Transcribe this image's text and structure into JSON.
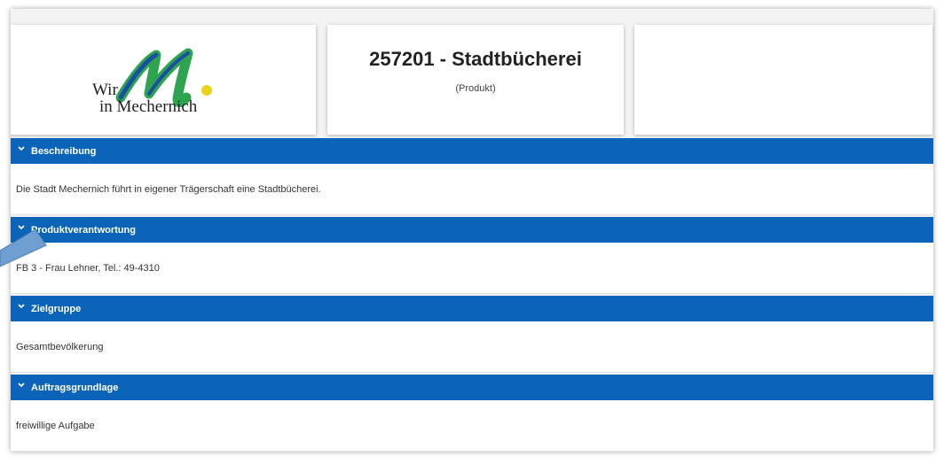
{
  "header": {
    "logo": {
      "line1": "Wir",
      "line2": "in Mechernich",
      "mark_colors": {
        "green": "#2ea44f",
        "blue": "#1a4fa3",
        "yellow": "#e8d21a"
      }
    },
    "title": "257201 - Stadtbücherei",
    "subtitle": "(Produkt)"
  },
  "sections": [
    {
      "label": "Beschreibung",
      "content": "Die Stadt Mechernich führt in eigener Trägerschaft eine Stadtbücherei."
    },
    {
      "label": "Produktverantwortung",
      "content": "FB 3 - Frau Lehner, Tel.: 49-4310"
    },
    {
      "label": "Zielgruppe",
      "content": "Gesamtbevölkerung"
    },
    {
      "label": "Auftragsgrundlage",
      "content": "freiwillige Aufgabe"
    }
  ],
  "colors": {
    "section_header_bg": "#0b64b8",
    "callout": "#6f9fd1"
  }
}
